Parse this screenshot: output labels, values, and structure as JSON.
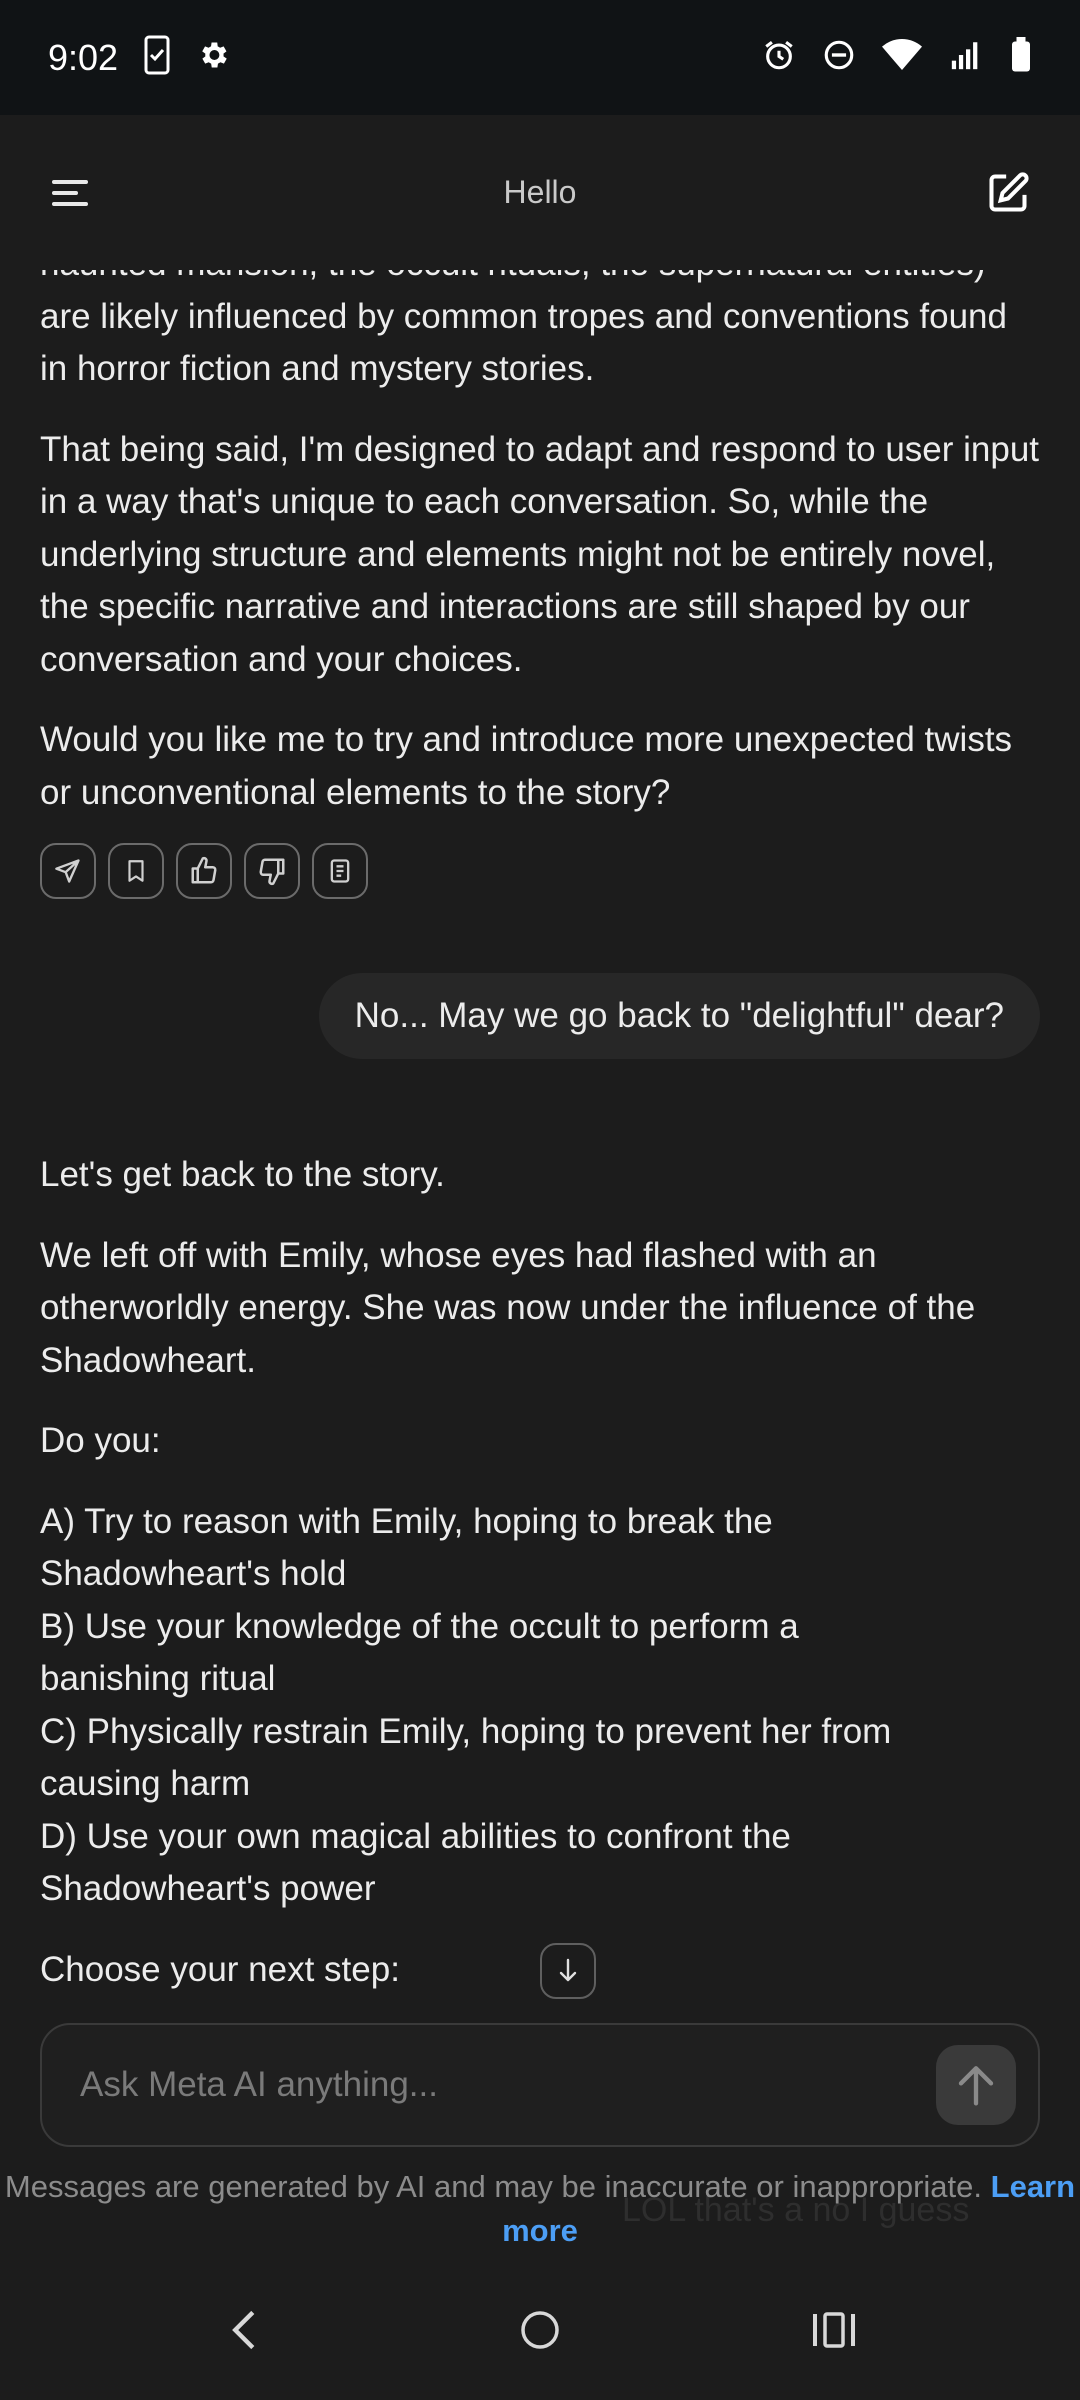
{
  "status_bar": {
    "time": "9:02",
    "left_icons": [
      "phone-screen-icon",
      "gear-icon"
    ],
    "right_icons": [
      "alarm-icon",
      "do-not-disturb-icon",
      "wifi-icon",
      "cell-signal-icon",
      "battery-icon"
    ]
  },
  "header": {
    "title": "Hello",
    "menu_icon": "menu-icon",
    "new_chat_icon": "new-chat-icon"
  },
  "conversation": {
    "ai_message_1": {
      "paragraphs": [
        "haunted mansion, the occult rituals, the supernatural entities) are likely influenced by common tropes and conventions found in horror fiction and mystery stories.",
        "That being said, I'm designed to adapt and respond to user input in a way that's unique to each conversation. So, while the underlying structure and elements might not be entirely novel, the specific narrative and interactions are still shaped by our conversation and your choices.",
        "Would you like me to try and introduce more unexpected twists or unconventional elements to the story?"
      ],
      "actions": [
        "share-icon",
        "bookmark-icon",
        "thumbs-up-icon",
        "thumbs-down-icon",
        "copy-icon"
      ]
    },
    "user_message": "No... May we go back to \"delightful\" dear?",
    "ai_message_2": {
      "intro": "Let's get back to the story.",
      "context": "We left off with Emily, whose eyes had flashed with an otherworldly energy. She was now under the influence of the Shadowheart.",
      "question": "Do you:",
      "options": [
        "A) Try to reason with Emily, hoping to break the",
        "Shadowheart's hold",
        "B) Use your knowledge of the occult to perform a",
        "banishing ritual",
        "C) Physically restrain Emily, hoping to prevent her from",
        "causing harm",
        "D) Use your own magical abilities to confront the",
        "Shadowheart's power"
      ],
      "prompt": "Choose your next step:"
    }
  },
  "input": {
    "placeholder": "Ask Meta AI anything...",
    "send_icon": "arrow-up-icon"
  },
  "disclaimer": {
    "text": "Messages are generated by AI and may be inaccurate or inappropriate.",
    "link": "Learn more"
  },
  "ghost_text": "LOL that's a no I guess",
  "nav": [
    "back-icon",
    "home-icon",
    "recents-icon"
  ],
  "colors": {
    "background": "#1c1c1c",
    "status_bar": "#101315",
    "bubble": "#272727",
    "link": "#4c9ef5"
  }
}
